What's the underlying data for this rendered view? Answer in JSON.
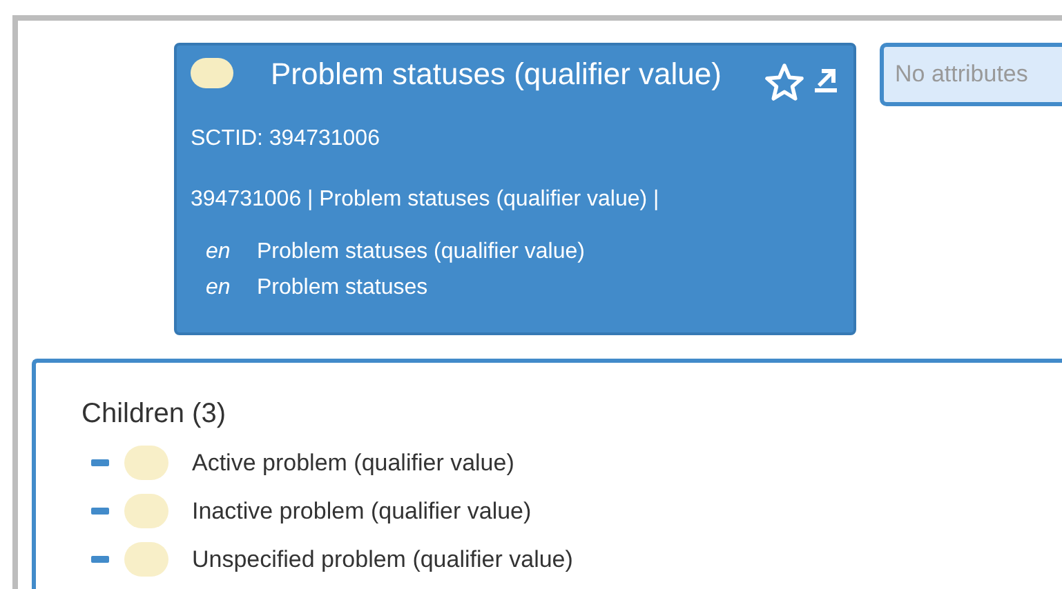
{
  "concept": {
    "title": "Problem statuses (qualifier value)",
    "sctid": "SCTID: 394731006",
    "fsn_line": "394731006 | Problem statuses (qualifier value) |",
    "descriptions": [
      {
        "lang": "en",
        "term": "Problem statuses (qualifier value)"
      },
      {
        "lang": "en",
        "term": "Problem statuses"
      }
    ]
  },
  "attributes": {
    "text": "No attributes"
  },
  "children": {
    "title": "Children (3)",
    "items": [
      {
        "label": "Active problem (qualifier value)"
      },
      {
        "label": "Inactive problem (qualifier value)"
      },
      {
        "label": "Unspecified problem (qualifier value)"
      }
    ]
  }
}
